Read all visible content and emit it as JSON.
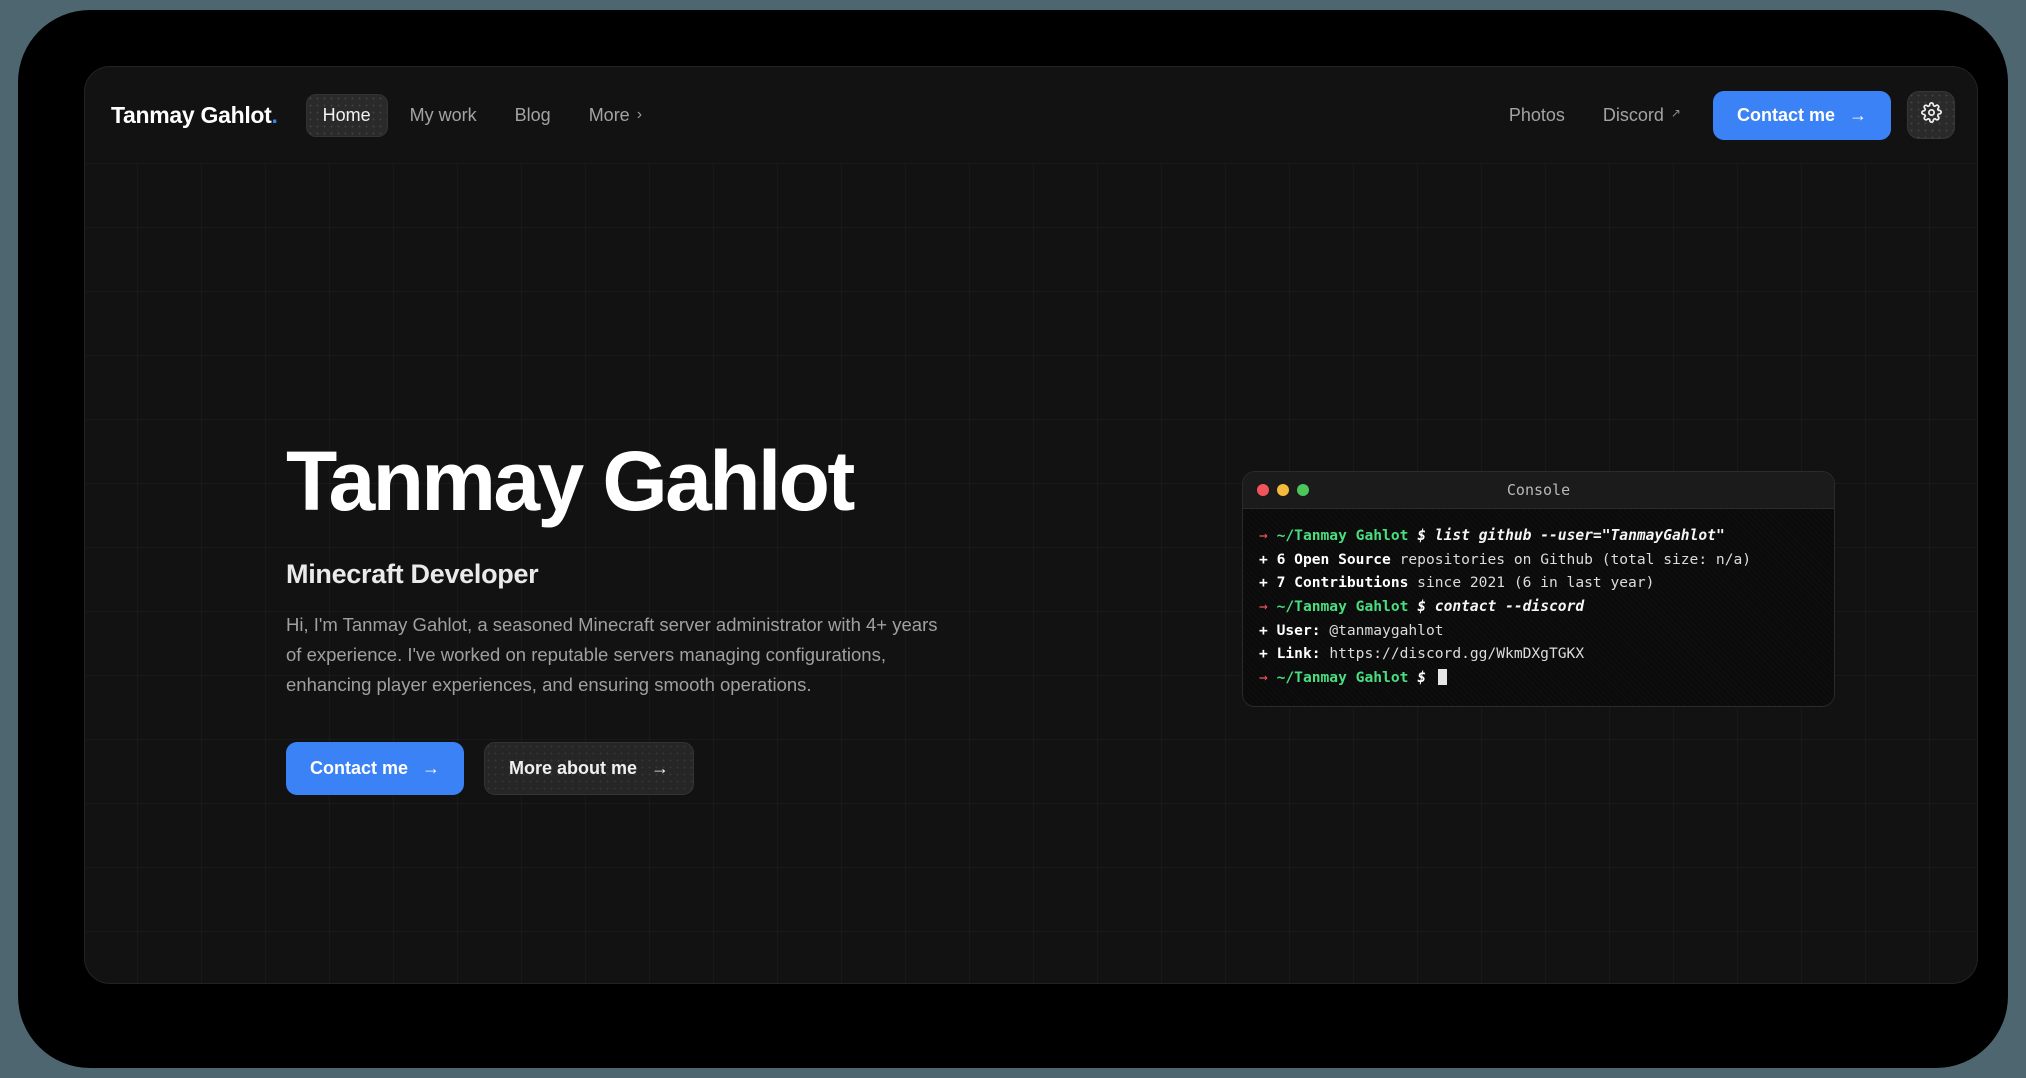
{
  "brand": {
    "name": "Tanmay Gahlot",
    "dot": "."
  },
  "nav": {
    "left_items": [
      {
        "label": "Home",
        "active": true
      },
      {
        "label": "My work",
        "active": false
      },
      {
        "label": "Blog",
        "active": false
      },
      {
        "label": "More",
        "active": false,
        "chevron": "›"
      }
    ],
    "right_items": [
      {
        "label": "Photos",
        "external": false
      },
      {
        "label": "Discord",
        "external": true,
        "ext_glyph": "↗"
      }
    ],
    "contact_button": {
      "label": "Contact me",
      "arrow": "→"
    },
    "settings_icon": "gear-icon"
  },
  "hero": {
    "title": "Tanmay Gahlot",
    "subtitle": "Minecraft Developer",
    "description": "Hi, I'm Tanmay Gahlot, a seasoned Minecraft server administrator with 4+ years of experience. I've worked on reputable servers managing configurations, enhancing player experiences, and ensuring smooth operations.",
    "primary_button": {
      "label": "Contact me",
      "arrow": "→"
    },
    "secondary_button": {
      "label": "More about me",
      "arrow": "→"
    }
  },
  "console": {
    "title": "Console",
    "traffic_lights": [
      "#f2545b",
      "#f5b93b",
      "#4cc55a"
    ],
    "lines": [
      {
        "type": "prompt",
        "arrow": "→",
        "path": "~/Tanmay Gahlot",
        "dollar": "$",
        "command": "list github --user=\"TanmayGahlot\""
      },
      {
        "type": "output",
        "plus": "+",
        "key": "6 Open Source",
        "value": " repositories on Github (total size: n/a)"
      },
      {
        "type": "output",
        "plus": "+",
        "key": "7 Contributions",
        "value": " since 2021 (6 in last year)"
      },
      {
        "type": "prompt",
        "arrow": "→",
        "path": "~/Tanmay Gahlot",
        "dollar": "$",
        "command": "contact --discord"
      },
      {
        "type": "output",
        "plus": "+",
        "key": "User:",
        "value": " @tanmaygahlot"
      },
      {
        "type": "output",
        "plus": "+",
        "key": "Link:",
        "value": " https://discord.gg/WkmDXgTGKX"
      },
      {
        "type": "prompt_cursor",
        "arrow": "→",
        "path": "~/Tanmay Gahlot",
        "dollar": "$",
        "command": ""
      }
    ]
  },
  "colors": {
    "accent": "#3b82f6",
    "page_bg": "#121212",
    "backdrop": "#4e6670",
    "terminal_green": "#4ade80",
    "terminal_red": "#f2545b"
  }
}
